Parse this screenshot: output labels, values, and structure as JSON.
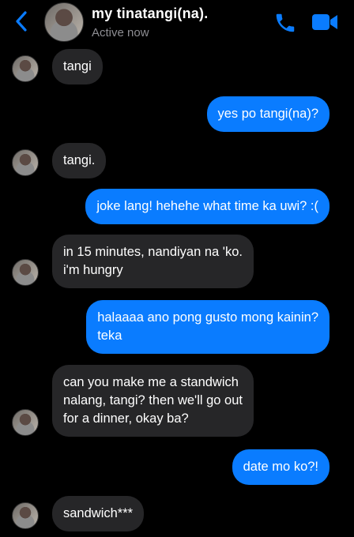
{
  "header": {
    "name": "my tinatangi(na).",
    "status": "Active now",
    "accent": "#0a7cff"
  },
  "icons": {
    "back": "chevron-left-icon",
    "call": "phone-icon",
    "video": "video-camera-icon"
  },
  "messages": [
    {
      "from": "them",
      "text": "tangi"
    },
    {
      "from": "me",
      "text": "yes po tangi(na)?"
    },
    {
      "from": "them",
      "text": "tangi."
    },
    {
      "from": "me",
      "text": "joke lang! hehehe what time ka uwi? :("
    },
    {
      "from": "them",
      "text": "in 15 minutes, nandiyan na 'ko.\ni'm hungry"
    },
    {
      "from": "me",
      "text": "halaaaa ano pong gusto mong kainin?\nteka"
    },
    {
      "from": "them",
      "text": "can you make me a standwich\nnalang, tangi? then we'll go out\nfor a dinner, okay ba?"
    },
    {
      "from": "me",
      "text": "date mo ko?!"
    },
    {
      "from": "them",
      "text": "sandwich***"
    }
  ],
  "colors": {
    "background": "#000000",
    "incoming_bubble": "#262628",
    "outgoing_bubble": "#0a7cff",
    "status_text": "#8e8e93"
  }
}
